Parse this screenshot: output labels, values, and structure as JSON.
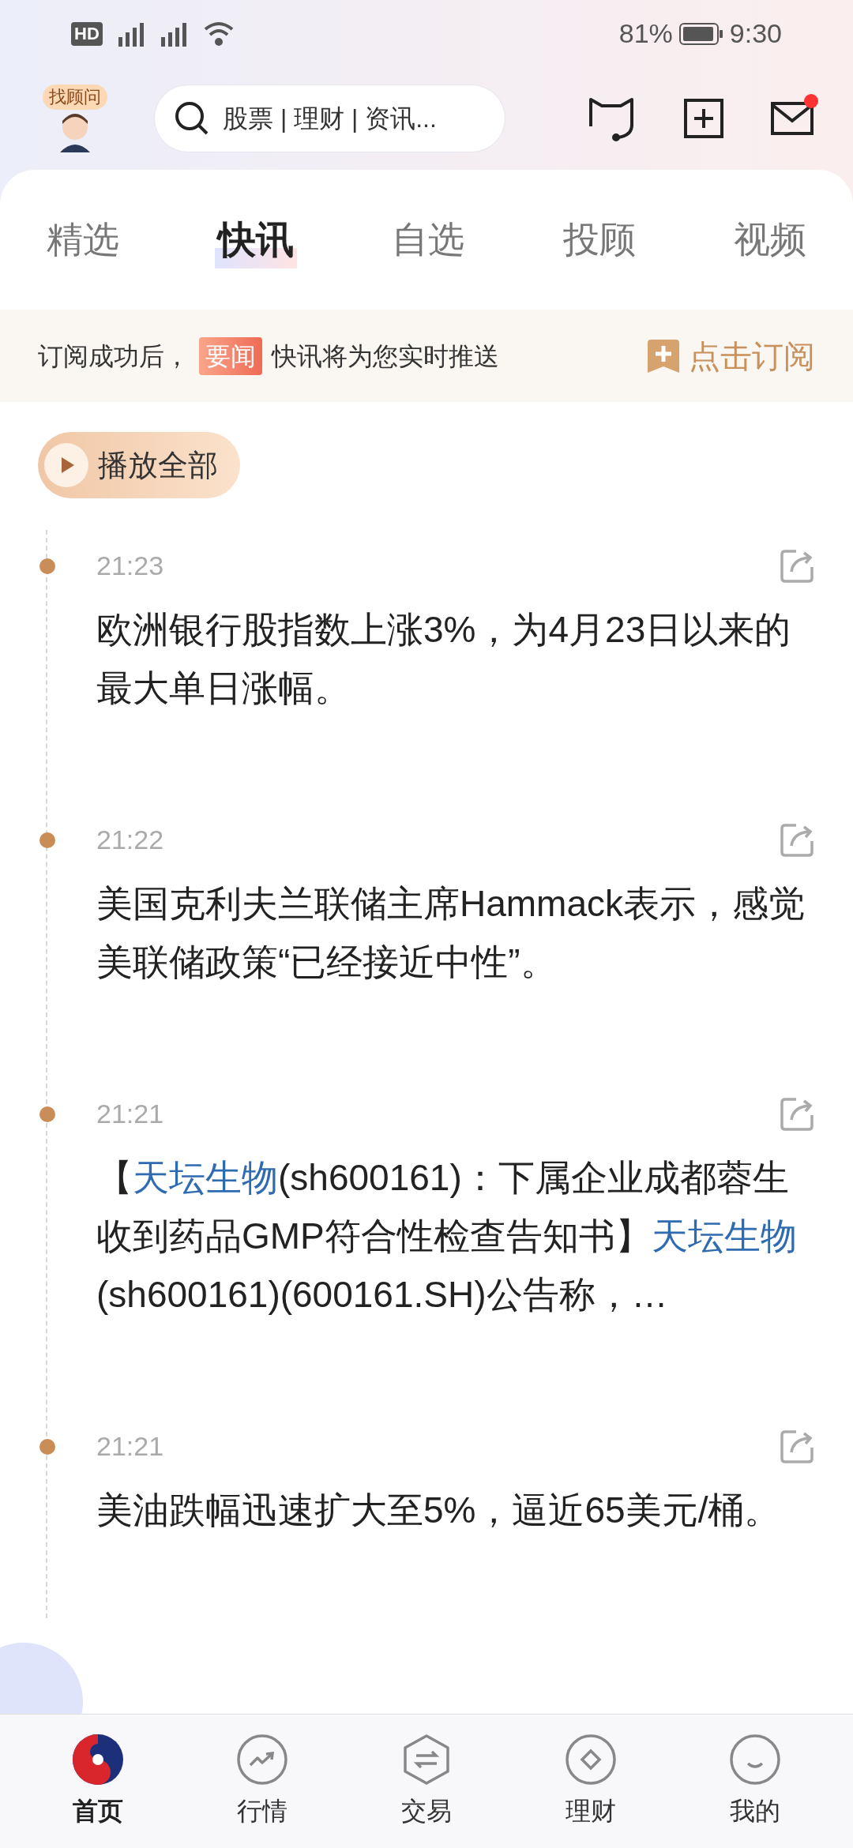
{
  "status_bar": {
    "network": "HD",
    "battery": "81%",
    "time": "9:30"
  },
  "header": {
    "advisor_badge": "找顾问",
    "search_placeholder": "股票 | 理财 | 资讯...",
    "mail_unread": true
  },
  "tabs": [
    {
      "label": "精选",
      "selected": false
    },
    {
      "label": "快讯",
      "selected": true
    },
    {
      "label": "自选",
      "selected": false
    },
    {
      "label": "投顾",
      "selected": false
    },
    {
      "label": "视频",
      "selected": false
    }
  ],
  "banner": {
    "before": "订阅成功后，",
    "tag": "要闻",
    "after": "快讯将为您实时推送",
    "action": "点击订阅"
  },
  "play_all": "播放全部",
  "news": [
    {
      "time": "21:23",
      "parts": [
        {
          "text": "欧洲银行股指数上涨3%，为4月23日以来的最大单日涨幅。",
          "link": false
        }
      ]
    },
    {
      "time": "21:22",
      "parts": [
        {
          "text": "美国克利夫兰联储主席Hammack表示，感觉美联储政策“已经接近中性”。",
          "link": false
        }
      ]
    },
    {
      "time": "21:21",
      "parts": [
        {
          "text": "【",
          "link": false
        },
        {
          "text": "天坛生物",
          "link": true
        },
        {
          "text": "(sh600161)：下属企业成都蓉生收到药品GMP符合性检查告知书】",
          "link": false
        },
        {
          "text": "天坛生物",
          "link": true
        },
        {
          "text": "(sh600161)(600161.SH)公告称，…",
          "link": false
        }
      ]
    },
    {
      "time": "21:21",
      "parts": [
        {
          "text": "美油跌幅迅速扩大至5%，逼近65美元/桶。",
          "link": false
        }
      ]
    }
  ],
  "bottom_nav": [
    {
      "label": "首页",
      "selected": true,
      "kind": "home"
    },
    {
      "label": "行情",
      "selected": false,
      "kind": "market"
    },
    {
      "label": "交易",
      "selected": false,
      "kind": "trade"
    },
    {
      "label": "理财",
      "selected": false,
      "kind": "wealth"
    },
    {
      "label": "我的",
      "selected": false,
      "kind": "me"
    }
  ]
}
